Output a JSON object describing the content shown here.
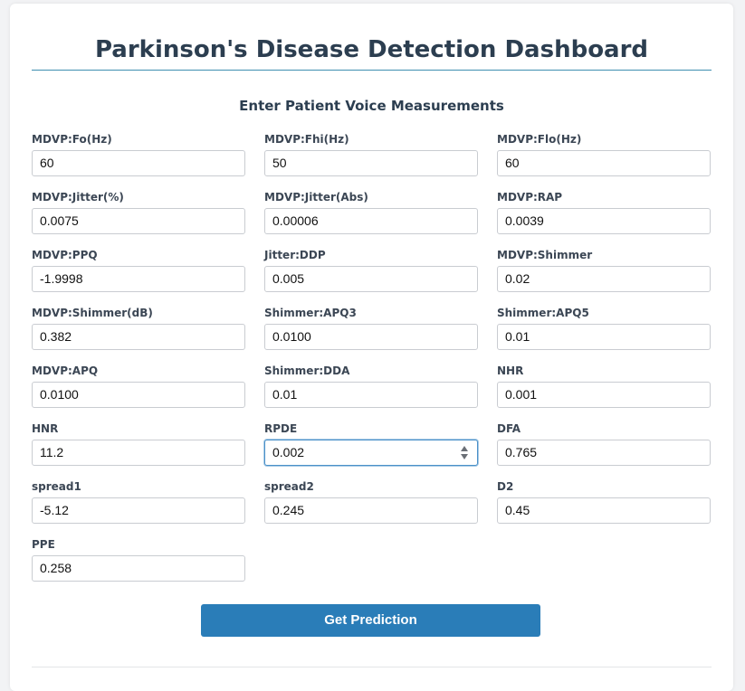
{
  "page": {
    "title": "Parkinson's Disease Detection Dashboard",
    "subtitle": "Enter Patient Voice Measurements"
  },
  "fields": [
    {
      "label": "MDVP:Fo(Hz)",
      "value": "60"
    },
    {
      "label": "MDVP:Fhi(Hz)",
      "value": "50"
    },
    {
      "label": "MDVP:Flo(Hz)",
      "value": "60"
    },
    {
      "label": "MDVP:Jitter(%)",
      "value": "0.0075"
    },
    {
      "label": "MDVP:Jitter(Abs)",
      "value": "0.00006"
    },
    {
      "label": "MDVP:RAP",
      "value": "0.0039"
    },
    {
      "label": "MDVP:PPQ",
      "value": "-1.9998"
    },
    {
      "label": "Jitter:DDP",
      "value": "0.005"
    },
    {
      "label": "MDVP:Shimmer",
      "value": "0.02"
    },
    {
      "label": "MDVP:Shimmer(dB)",
      "value": "0.382"
    },
    {
      "label": "Shimmer:APQ3",
      "value": "0.0100"
    },
    {
      "label": "Shimmer:APQ5",
      "value": "0.01"
    },
    {
      "label": "MDVP:APQ",
      "value": "0.0100"
    },
    {
      "label": "Shimmer:DDA",
      "value": "0.01"
    },
    {
      "label": "NHR",
      "value": "0.001"
    },
    {
      "label": "HNR",
      "value": "11.2"
    },
    {
      "label": "RPDE",
      "value": "0.002"
    },
    {
      "label": "DFA",
      "value": "0.765"
    },
    {
      "label": "spread1",
      "value": "-5.12"
    },
    {
      "label": "spread2",
      "value": "0.245"
    },
    {
      "label": "D2",
      "value": "0.45"
    },
    {
      "label": "PPE",
      "value": "0.258"
    }
  ],
  "focused_field": "RPDE",
  "actions": {
    "predict_label": "Get Prediction"
  },
  "colors": {
    "heading": "#2c3e50",
    "accent": "#2a7db8",
    "focus_border": "#4a90c8"
  }
}
